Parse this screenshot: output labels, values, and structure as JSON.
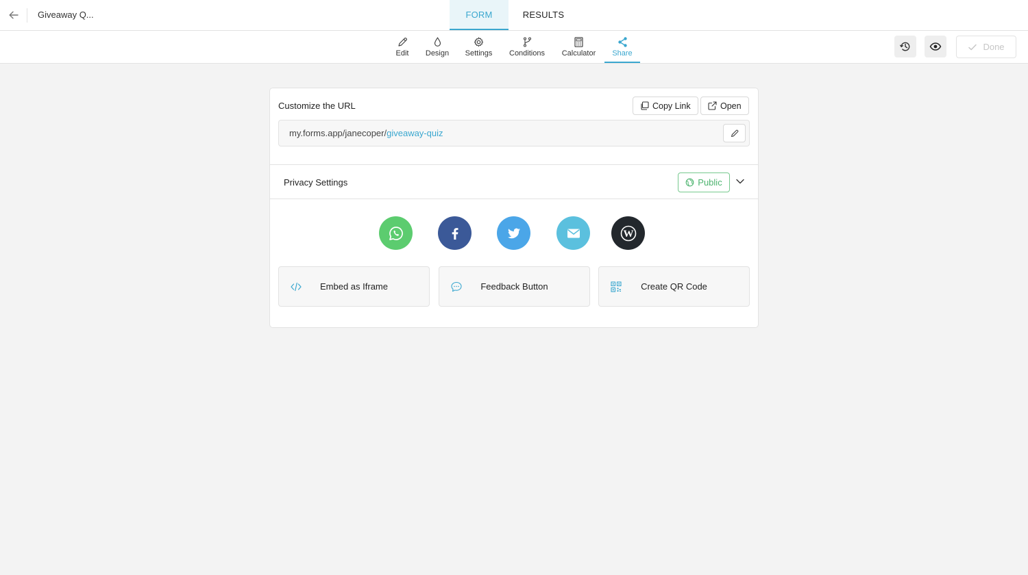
{
  "header": {
    "form_title": "Giveaway Q...",
    "tabs": [
      {
        "label": "FORM",
        "active": true
      },
      {
        "label": "RESULTS",
        "active": false
      }
    ]
  },
  "toolbar": {
    "items": [
      {
        "label": "Edit",
        "icon": "pencil-icon"
      },
      {
        "label": "Design",
        "icon": "droplet-icon"
      },
      {
        "label": "Settings",
        "icon": "gear-icon"
      },
      {
        "label": "Conditions",
        "icon": "branch-icon"
      },
      {
        "label": "Calculator",
        "icon": "calculator-icon"
      },
      {
        "label": "Share",
        "icon": "share-icon",
        "active": true
      }
    ],
    "done_label": "Done"
  },
  "share": {
    "url_title": "Customize the URL",
    "copy_link_label": "Copy Link",
    "open_label": "Open",
    "url_base": "my.forms.app/janecoper/",
    "url_slug": "giveaway-quiz",
    "privacy_label": "Privacy Settings",
    "privacy_value": "Public",
    "social": [
      "whatsapp-icon",
      "facebook-icon",
      "twitter-icon",
      "email-icon",
      "wordpress-icon"
    ],
    "embed_label": "Embed as Iframe",
    "feedback_label": "Feedback Button",
    "qr_label": "Create QR Code"
  },
  "colors": {
    "accent": "#3aa7cf",
    "whatsapp": "#5ccc6f",
    "facebook": "#3b5998",
    "twitter": "#4ba6e8",
    "email": "#5bc0de",
    "wordpress": "#23282d",
    "public_green": "#4cb36e"
  }
}
